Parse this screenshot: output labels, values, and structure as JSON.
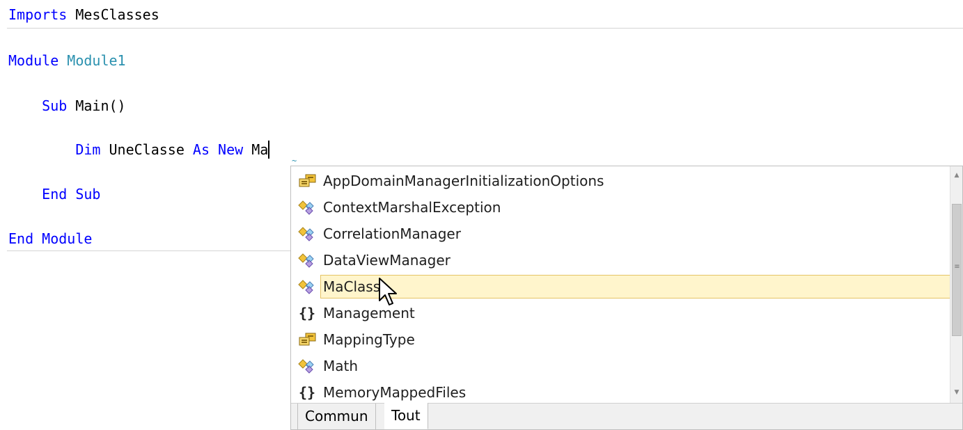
{
  "code": {
    "line1": {
      "kw": "Imports",
      "rest": " MesClasses"
    },
    "line2": {
      "kw": "Module",
      "type": "Module1"
    },
    "line3": {
      "indent": "    ",
      "kw": "Sub",
      "rest": " Main()"
    },
    "line4": {
      "indent": "        ",
      "kw1": "Dim",
      "mid": " UneClasse ",
      "kw2": "As",
      "sp": " ",
      "kw3": "New",
      "typed": " Ma"
    },
    "line5": {
      "indent": "    ",
      "kw1": "End",
      "sp": " ",
      "kw2": "Sub"
    },
    "line6": {
      "kw1": "End",
      "sp": " ",
      "kw2": "Module"
    }
  },
  "completion": {
    "items": [
      {
        "label": "AppDomainManagerInitializationOptions",
        "icon": "enum-icon"
      },
      {
        "label": "ContextMarshalException",
        "icon": "class-icon"
      },
      {
        "label": "CorrelationManager",
        "icon": "class-icon"
      },
      {
        "label": "DataViewManager",
        "icon": "class-icon"
      },
      {
        "label": "MaClasse",
        "icon": "class-icon",
        "selected": true
      },
      {
        "label": "Management",
        "icon": "namespace-icon"
      },
      {
        "label": "MappingType",
        "icon": "enum-icon"
      },
      {
        "label": "Math",
        "icon": "class-icon"
      },
      {
        "label": "MemoryMappedFiles",
        "icon": "namespace-icon"
      }
    ],
    "tabs": [
      "Commun",
      "Tout"
    ],
    "active_tab": "Tout"
  },
  "colors": {
    "keyword": "#0000ff",
    "type": "#2b91af",
    "selection_bg": "#fff5cc",
    "selection_border": "#e5c365"
  }
}
